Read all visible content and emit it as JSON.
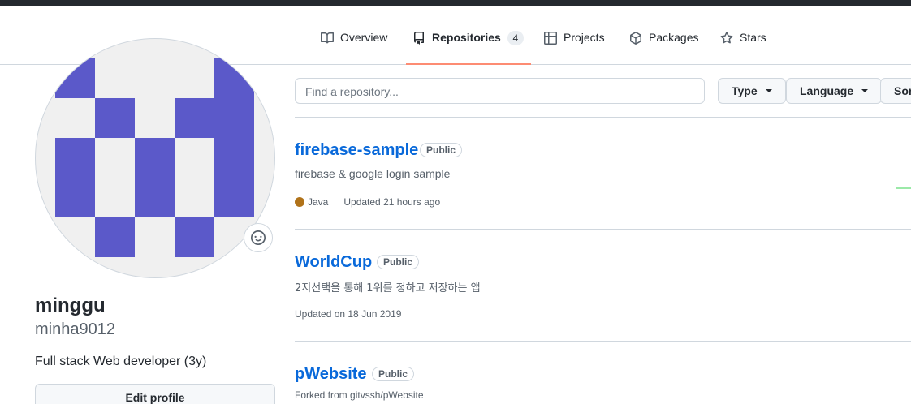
{
  "nav": {
    "tabs": [
      {
        "label": "Overview",
        "icon": "book-icon"
      },
      {
        "label": "Repositories",
        "icon": "repo-icon",
        "count": "4"
      },
      {
        "label": "Projects",
        "icon": "table-icon"
      },
      {
        "label": "Packages",
        "icon": "package-icon"
      },
      {
        "label": "Stars",
        "icon": "star-icon"
      }
    ],
    "selected": "Repositories"
  },
  "profile": {
    "fullname": "minggu",
    "username": "minha9012",
    "bio": "Full stack Web developer (3y)",
    "edit_label": "Edit profile",
    "avatar_color": "#5b59c9"
  },
  "filters": {
    "search_placeholder": "Find a repository...",
    "type_label": "Type",
    "language_label": "Language",
    "sort_label": "Sort"
  },
  "repos": [
    {
      "name": "firebase-sample",
      "visibility": "Public",
      "description": "firebase & google login sample",
      "language": "Java",
      "language_color": "#b07219",
      "updated": "Updated 21 hours ago"
    },
    {
      "name": "WorldCup",
      "visibility": "Public",
      "description": "2지선택을 통해 1위를 정하고 저장하는 앱",
      "updated": "Updated on 18 Jun 2019"
    },
    {
      "name": "pWebsite",
      "visibility": "Public",
      "forked_from": "Forked from gitvssh/pWebsite"
    }
  ]
}
